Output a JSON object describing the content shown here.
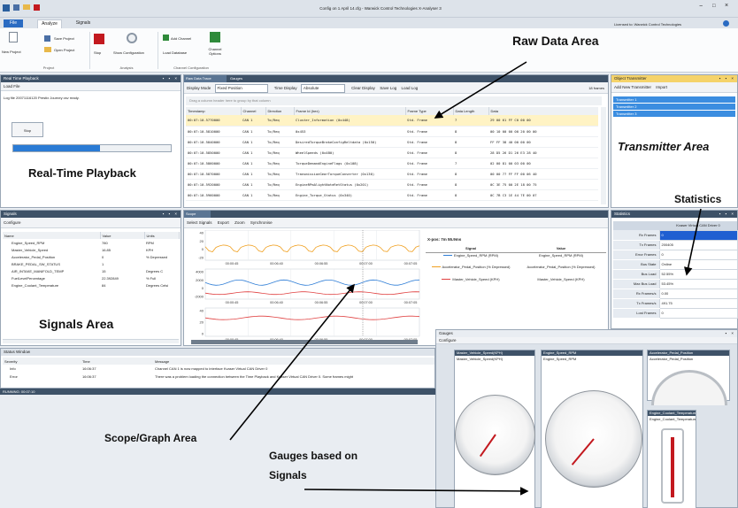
{
  "window": {
    "title": "Config on 1 April 14.cfg - Warwick Control Technologies X-Analyser 3",
    "licensed": "Licensed to: Warwick Control Technologies"
  },
  "ribbon": {
    "tabs": [
      "File",
      "Analyze",
      "Signals"
    ],
    "project_group": {
      "new": "New Project",
      "save": "Save Project",
      "open": "Open Project",
      "label": "Project"
    },
    "analysis_group": {
      "stop": "Stop",
      "show_config": "Show Configuration",
      "label": "Analysis"
    },
    "channel_group": {
      "add": "Add Channel",
      "load_db": "Load Database",
      "options": "Channel Options",
      "label": "Channel Configuration"
    }
  },
  "playback": {
    "title": "Real Time Playback",
    "load_file": "Load File",
    "log_text": "Log file 20071116120 Prestix Journey csv ready.",
    "stop": "Stop",
    "progress": 0.55
  },
  "raw_data": {
    "tabs": [
      "Raw Data Trace",
      "Gauges"
    ],
    "display_mode_label": "Display Mode",
    "display_mode_value": "Fixed Position",
    "time_display_label": "Time Display",
    "time_display_value": "Absolute",
    "clear": "Clear Display",
    "save_log": "Save Log",
    "load_log": "Load Log",
    "frames_count": "18 frames",
    "group_hint": "Drag a column header here to group by that column",
    "columns": [
      "Timestamp",
      "Channel",
      "Direction",
      "Frame Id (hex)",
      "Frame Type",
      "Data Length",
      "Data"
    ],
    "rows": [
      [
        "00:07:10.5770000",
        "CAN 1",
        "To/Req",
        "Cluster_Information (0x448)",
        "Std. Frame",
        "7",
        "29 00 61 FF C0 00 00"
      ],
      [
        "00:07:10.5810000",
        "CAN 1",
        "To/Req",
        "0x453",
        "Std. Frame",
        "8",
        "00 10 00 00 00 20 00 00"
      ],
      [
        "00:07:10.5840000",
        "CAN 1",
        "To/Req",
        "DesiredTorqueBrakeConfigReltdata (0x150)",
        "Std. Frame",
        "8",
        "FF FF 38 40 00 00 00"
      ],
      [
        "00:07:10.5850000",
        "CAN 1",
        "To/Req",
        "WheelSpeeds (0x4B0)",
        "Std. Frame",
        "8",
        "28 D5 26 D1 26 E3 28 40"
      ],
      [
        "00:07:10.5860000",
        "CAN 1",
        "To/Req",
        "TorqueDemandEngineFlags (0x108)",
        "Std. Frame",
        "7",
        "02 00 81 00 03 00 00"
      ],
      [
        "00:07:10.5870000",
        "CAN 1",
        "To/Req",
        "TransmissionGearTorqueConverter (0x130)",
        "Std. Frame",
        "8",
        "00 00 77 FF FF 00 06 40"
      ],
      [
        "00:07:10.5920000",
        "CAN 1",
        "To/Req",
        "EngineRPmAlightNoteRetStatus (0x201)",
        "Std. Frame",
        "8",
        "0C 3E 75 00 2E 18 00 75"
      ],
      [
        "00:07:10.5960000",
        "CAN 1",
        "To/Req",
        "Engine_Torque_Status (0x340)",
        "Std. Frame",
        "8",
        "0C 7B C3 1E 44 7E 00 07"
      ]
    ]
  },
  "transmitter": {
    "title": "Object Transmitter",
    "add": "Add New Transmitter",
    "import": "Import",
    "items": [
      "Transmitter 1",
      "Transmitter 2",
      "Transmitter 3"
    ]
  },
  "signals": {
    "title": "Signals",
    "configure": "Configure",
    "columns": [
      "Name",
      "Value",
      "Units"
    ],
    "rows": [
      [
        "Engine_Speed_RPM",
        "780",
        "RPM"
      ],
      [
        "Master_Vehicle_Speed",
        "16.85",
        "KPH"
      ],
      [
        "Accelerator_Pedal_Position",
        "0",
        "% Depressed"
      ],
      [
        "BRAKE_PEDAL_SW_STATUS",
        "1",
        ""
      ],
      [
        "AIR_INTAKE_MANIFOLD_TEMP",
        "15",
        "Degrees C"
      ],
      [
        "FuelLevelPercentage",
        "22.392849",
        "% Full"
      ],
      [
        "Engine_Coolant_Temperature",
        "84",
        "Degrees Celsi"
      ]
    ]
  },
  "scope": {
    "title": "Scope",
    "menu": [
      "Select Signals",
      "Export",
      "Zoom",
      "Synchronise"
    ],
    "xticks": [
      "00:00:45",
      "00:06:40",
      "00:06:55",
      "00:07:00",
      "00:07:05"
    ],
    "ytick_sets": [
      [
        "40",
        "20",
        "0",
        "-20"
      ],
      [
        "4000",
        "2000",
        "0",
        "-2000"
      ],
      [
        "40",
        "20",
        "0"
      ]
    ],
    "xpos": "X-pos: 7m 55.9ms",
    "legend_headers": [
      "Signal",
      "Value"
    ],
    "legend": [
      {
        "signal": "Engine_Speed_RPM (RPM)",
        "value": "Engine_Speed_RPM (RPM)",
        "color": "#2e7dd6"
      },
      {
        "signal": "Accelerator_Pedal_Position (% Depressed)",
        "value": "Accelerator_Pedal_Position (% Depressed)",
        "color": "#f0a020"
      },
      {
        "signal": "Master_Vehicle_Speed (KPH)",
        "value": "Master_Vehicle_Speed (KPH)",
        "color": "#e04040"
      }
    ]
  },
  "statistics": {
    "title": "Statistics",
    "header": "Kvaser Virtual CAN Driver 0",
    "rows": [
      [
        "Rx Frames",
        "0"
      ],
      [
        "Tx Frames",
        "200405"
      ],
      [
        "Error Frames",
        "0"
      ],
      [
        "Bus State",
        "Online"
      ],
      [
        "Bus Load",
        "52.55%"
      ],
      [
        "Max Bus Load",
        "53.45%"
      ],
      [
        "Rx Frames/s",
        "0.00"
      ],
      [
        "Tx Frames/s",
        "491.75"
      ],
      [
        "Lost Frames",
        "0"
      ]
    ]
  },
  "status": {
    "title": "Status Window",
    "columns": [
      "Severity",
      "Time",
      "Message"
    ],
    "rows": [
      [
        "Info",
        "16:06:37",
        "Channel CAN 1 is now mapped to interface Kvaser Virtual CAN Driver 0"
      ],
      [
        "Error",
        "16:06:37",
        "There was a problem loading the connection between the Time Playback and Kvaser Virtual CAN Driver 0. Some frames might"
      ]
    ],
    "running": "RUNNING: 00:07:10"
  },
  "gauges": {
    "title": "Gauges",
    "configure": "Configure",
    "speed_title": "Master_Vehicle_Speed(KPH)",
    "rpm_title": "Engine_Speed_RPM",
    "pedal_title": "Accelerator_Pedal_Position",
    "coolant_title": "Engine_Coolant_Temperature(C)"
  },
  "annotations": {
    "raw": "Raw Data Area",
    "playback": "Real-Time Playback",
    "transmitter": "Transmitter Area",
    "statistics": "Statistics",
    "signals": "Signals Area",
    "scope": "Scope/Graph Area",
    "gauges_line1": "Gauges based on",
    "gauges_line2": "Signals"
  },
  "colors": {
    "title_bar": "#3e5268",
    "selection": "#3b8de0",
    "accent_blue": "#2e7dd6",
    "accent_orange": "#f0a020",
    "accent_red": "#e04040"
  }
}
